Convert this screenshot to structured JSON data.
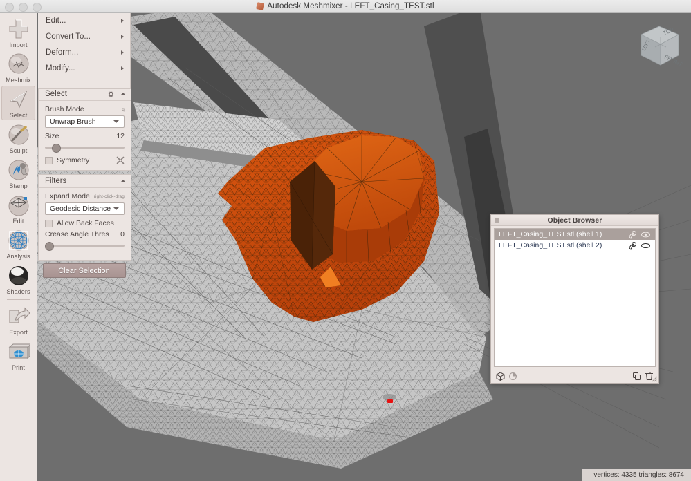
{
  "window": {
    "title": "Autodesk Meshmixer - LEFT_Casing_TEST.stl",
    "app_icon": "meshmixer-logo-icon",
    "traffic_lights": [
      "close-button",
      "minimize-button",
      "zoom-button"
    ]
  },
  "sidebar": {
    "items": [
      {
        "label": "Import",
        "icon": "plus-import-icon",
        "active": false
      },
      {
        "label": "Meshmix",
        "icon": "meshmix-sphere-icon",
        "active": false
      },
      {
        "label": "Select",
        "icon": "cursor-arrow-icon",
        "active": true
      },
      {
        "label": "Sculpt",
        "icon": "brush-sphere-icon",
        "active": false
      },
      {
        "label": "Stamp",
        "icon": "stamp-sphere-icon",
        "active": false
      },
      {
        "label": "Edit",
        "icon": "edit-mesh-icon",
        "active": false
      },
      {
        "label": "Analysis",
        "icon": "analysis-grid-icon",
        "active": false
      },
      {
        "label": "Shaders",
        "icon": "shaders-sphere-icon",
        "active": false
      },
      {
        "label": "Export",
        "icon": "export-arrow-icon",
        "active": false
      },
      {
        "label": "Print",
        "icon": "printer-icon",
        "active": false
      }
    ]
  },
  "menu": {
    "items": [
      {
        "label": "Edit...",
        "submenu_arrow": "chevron-right-icon"
      },
      {
        "label": "Convert To...",
        "submenu_arrow": "chevron-right-icon"
      },
      {
        "label": "Deform...",
        "submenu_arrow": "chevron-right-icon"
      },
      {
        "label": "Modify...",
        "submenu_arrow": "chevron-right-icon"
      }
    ]
  },
  "select_panel": {
    "title": "Select",
    "gear_icon": "gear-icon",
    "collapse_icon": "caret-up-icon",
    "brush_mode_label": "Brush Mode",
    "brush_mode_shortcut": "q",
    "brush_mode_value": "Unwrap Brush",
    "size_label": "Size",
    "size_value": "12",
    "size_percent": 11,
    "symmetry_label": "Symmetry",
    "symmetry_checked": false,
    "symmetry_tool_icon": "wrench-tools-icon"
  },
  "filters_panel": {
    "title": "Filters",
    "collapse_icon": "caret-up-icon",
    "expand_mode_label": "Expand Mode",
    "expand_mode_hint": "right-click-drag",
    "expand_mode_value": "Geodesic Distance",
    "allow_back_faces_label": "Allow Back Faces",
    "allow_back_faces_checked": false,
    "crease_angle_label": "Crease Angle Thres",
    "crease_angle_value": "0",
    "crease_percent": 2
  },
  "actions": {
    "clear_selection_label": "Clear Selection"
  },
  "object_browser": {
    "title": "Object Browser",
    "close_icon": "close-box-icon",
    "rows": [
      {
        "name": "LEFT_Casing_TEST.stl (shell 1)",
        "selected": true,
        "edit_icon": "brush-pointer-icon",
        "visibility_icon": "eye-open-icon"
      },
      {
        "name": "LEFT_Casing_TEST.stl (shell 2)",
        "selected": false,
        "edit_icon": "brush-pointer-icon",
        "visibility_icon": "eye-closed-icon"
      }
    ],
    "footer_left_icons": [
      "cube-icon",
      "pie-shader-icon"
    ],
    "footer_right_icons": [
      "duplicate-icon",
      "trash-icon"
    ],
    "resize_handle": "resize-grip-icon"
  },
  "statusbar": {
    "text": "vertices: 4335 triangles: 8674"
  },
  "viewport": {
    "nav_cube": {
      "top_label": "TOP",
      "front_label": "FRONT",
      "left_label": "LEFT"
    },
    "brush_cursor": "brush-cursor-indicator",
    "selection_color": "#c8490d",
    "mesh_color": "#c9c9c9",
    "background_color": "#6e6e6e"
  }
}
